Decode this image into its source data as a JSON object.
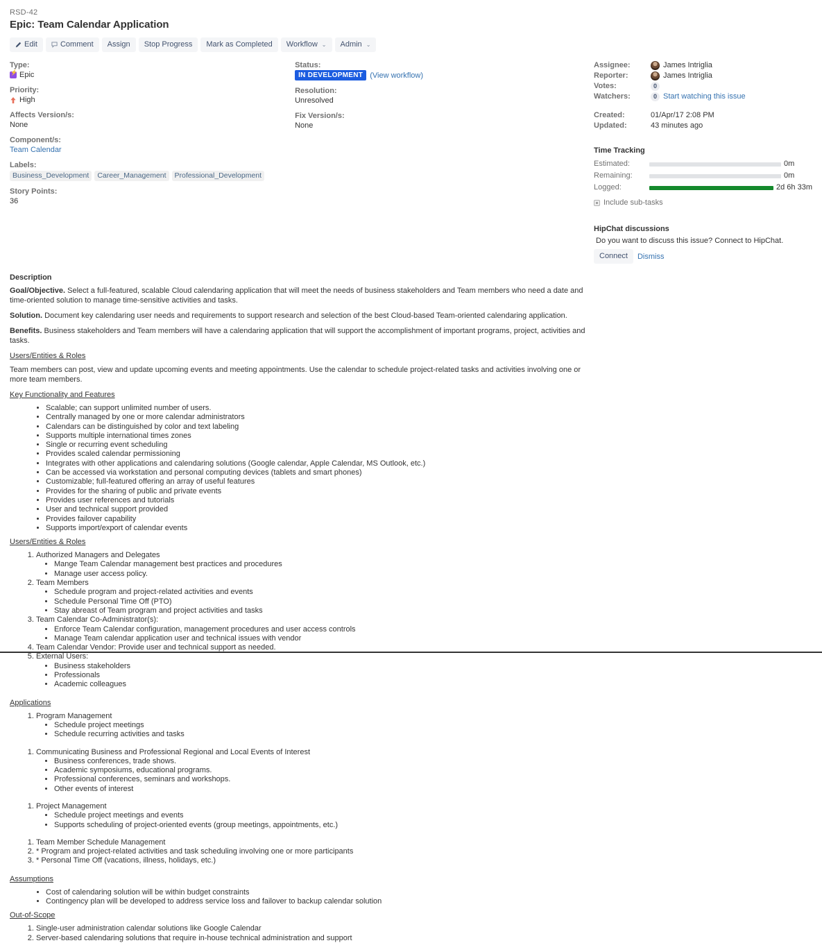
{
  "issue": {
    "key": "RSD-42",
    "title": "Epic: Team Calendar Application"
  },
  "toolbar": {
    "edit": "Edit",
    "comment": "Comment",
    "assign": "Assign",
    "stop_progress": "Stop Progress",
    "mark_completed": "Mark as Completed",
    "workflow": "Workflow",
    "admin": "Admin",
    "caret": "⌄"
  },
  "details": {
    "type_label": "Type:",
    "type_value": "Epic",
    "priority_label": "Priority:",
    "priority_value": "High",
    "affects_label": "Affects Version/s:",
    "affects_value": "None",
    "component_label": "Component/s:",
    "component_value": "Team Calendar",
    "labels_label": "Labels:",
    "labels": [
      "Business_Development",
      "Career_Management",
      "Professional_Development"
    ],
    "story_points_label": "Story Points:",
    "story_points_value": "36",
    "status_label": "Status:",
    "status_value": "IN DEVELOPMENT",
    "view_workflow": "(View workflow)",
    "resolution_label": "Resolution:",
    "resolution_value": "Unresolved",
    "fix_version_label": "Fix Version/s:",
    "fix_version_value": "None"
  },
  "people": {
    "assignee_label": "Assignee:",
    "assignee_value": "James Intriglia",
    "reporter_label": "Reporter:",
    "reporter_value": "James Intriglia",
    "votes_label": "Votes:",
    "votes_value": "0",
    "watchers_label": "Watchers:",
    "watchers_value": "0",
    "watch_link": "Start watching this issue",
    "created_label": "Created:",
    "created_value": "01/Apr/17 2:08 PM",
    "updated_label": "Updated:",
    "updated_value": "43 minutes ago"
  },
  "time_tracking": {
    "title": "Time Tracking",
    "estimated_label": "Estimated:",
    "estimated_value": "0m",
    "estimated_pct": 0,
    "remaining_label": "Remaining:",
    "remaining_value": "0m",
    "remaining_pct": 0,
    "logged_label": "Logged:",
    "logged_value": "2d 6h 33m",
    "logged_pct": 100,
    "include_subtasks": "Include sub-tasks",
    "bar_done_color": "#14892c",
    "bar_track_color": "#e1e3e6"
  },
  "hipchat": {
    "title": "HipChat discussions",
    "text": "Do you want to discuss this issue? Connect to HipChat.",
    "connect": "Connect",
    "dismiss": "Dismiss"
  },
  "description": {
    "heading": "Description",
    "goal_lead": "Goal/Objective.",
    "goal_text": " Select a full-featured, scalable Cloud calendaring application that will meet the needs of business stakeholders and Team members who need a date and time-oriented solution to manage time-sensitive activities and tasks.",
    "solution_lead": "Solution.",
    "solution_text": " Document key calendaring user needs and requirements to support research and selection of the best Cloud-based Team-oriented calendaring application.",
    "benefits_lead": "Benefits.",
    "benefits_text": " Business stakeholders and Team members will have a calendaring application that will support the accomplishment of important programs, project, activities and tasks.",
    "users_roles_head_1": "Users/Entities & Roles",
    "users_roles_para": "Team members can post, view and update upcoming events and meeting appointments. Use the calendar to schedule project-related tasks and activities involving one or more team members.",
    "key_features_head": "Key Functionality and Features",
    "key_features": [
      "Scalable; can support unlimited number of users.",
      "Centrally managed by one or more calendar administrators",
      "Calendars can be distinguished by color and text labeling",
      "Supports multiple international times zones",
      "Single or recurring event scheduling",
      "Provides scaled calendar permissioning",
      "Integrates with other applications and calendaring solutions (Google calendar, Apple Calendar, MS Outlook, etc.)",
      "Can be accessed via workstation and personal computing devices (tablets and smart phones)",
      "Customizable; full-featured offering an array of useful features",
      "Provides for the sharing of public and private events",
      "Provides user references and tutorials",
      "User and technical support provided",
      "Provides failover capability",
      "Supports import/export of calendar events"
    ],
    "users_roles_head_2": "Users/Entities & Roles",
    "users_roles_items": [
      {
        "text": "Authorized Managers and Delegates",
        "sub": [
          "Mange Team Calendar management best practices and procedures",
          "Manage user access policy."
        ]
      },
      {
        "text": "Team Members",
        "sub": [
          "Schedule program and project-related activities and events",
          "Schedule Personal Time Off (PTO)",
          "Stay abreast of Team program and project activities and tasks"
        ]
      },
      {
        "text": "Team Calendar Co-Administrator(s):",
        "sub": [
          "Enforce Team Calendar configuration, management procedures and user access controls",
          "Manage Team calendar application user and technical issues with vendor"
        ]
      },
      {
        "text": "Team Calendar Vendor: Provide user and technical support as needed.",
        "sub": []
      },
      {
        "text": "External Users:",
        "sub": [
          "Business stakeholders",
          "Professionals",
          "Academic colleagues"
        ]
      }
    ],
    "applications_head": "Applications",
    "applications_groups": [
      {
        "items": [
          {
            "text": "Program Management",
            "sub": [
              "Schedule project meetings",
              "Schedule recurring activities and tasks"
            ]
          }
        ]
      },
      {
        "items": [
          {
            "text": "Communicating Business and Professional Regional and Local Events of Interest",
            "sub": [
              "Business conferences, trade shows.",
              "Academic symposiums, educational programs.",
              "Professional conferences, seminars and workshops.",
              "Other events of interest"
            ]
          }
        ]
      },
      {
        "items": [
          {
            "text": "Project Management",
            "sub": [
              "Schedule project meetings and events",
              "Supports scheduling of project-oriented events (group meetings, appointments, etc.)"
            ]
          }
        ]
      },
      {
        "items": [
          {
            "text": "Team Member Schedule Management",
            "sub": []
          },
          {
            "text": "* Program and project-related activities and task scheduling involving one or more participants",
            "sub": []
          },
          {
            "text": "* Personal Time Off (vacations, illness, holidays, etc.)",
            "sub": []
          }
        ]
      }
    ],
    "assumptions_head": "Assumptions",
    "assumptions": [
      "Cost of calendaring solution will be within budget constraints",
      "Contingency plan will be developed to address service loss and failover to backup calendar solution"
    ],
    "out_of_scope_head": "Out-of-Scope",
    "out_of_scope": [
      "Single-user administration calendar solutions like Google Calendar",
      "Server-based calendaring solutions that require in-house technical administration and support"
    ]
  }
}
